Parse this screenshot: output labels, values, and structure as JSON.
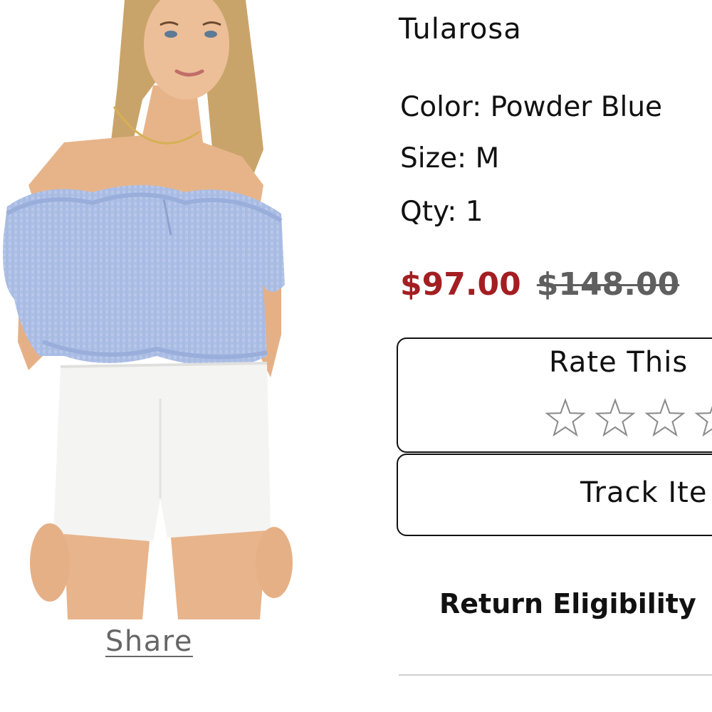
{
  "product": {
    "brand": "Tularosa",
    "color_text": "Color: Powder Blue",
    "size_text": "Size: M",
    "qty_text": "Qty: 1",
    "sale_price": "$97.00",
    "original_price": "$148.00"
  },
  "rating": {
    "title": "Rate This",
    "star_count": 5,
    "selected": 0
  },
  "actions": {
    "track_label": "Track Ite",
    "share_label": "Share",
    "return_label": "Return Eligibility"
  },
  "colors": {
    "sale_price": "#a31e22",
    "strikethrough_price": "#5f5f5f",
    "card_border": "#111111"
  },
  "icons": {
    "star": "star-outline-icon"
  }
}
